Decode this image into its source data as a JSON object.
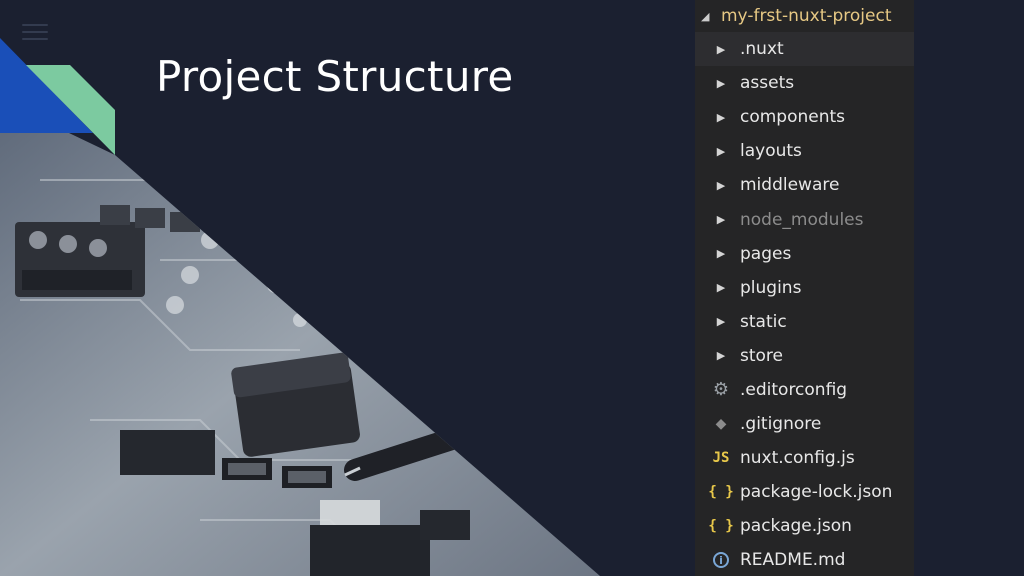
{
  "slide": {
    "title": "Project Structure"
  },
  "explorer": {
    "root_label": "my-frst-nuxt-project",
    "items": [
      {
        "label": ".nuxt",
        "icon": "chevron-right-icon",
        "kind": "folder"
      },
      {
        "label": "assets",
        "icon": "chevron-right-icon",
        "kind": "folder"
      },
      {
        "label": "components",
        "icon": "chevron-right-icon",
        "kind": "folder"
      },
      {
        "label": "layouts",
        "icon": "chevron-right-icon",
        "kind": "folder"
      },
      {
        "label": "middleware",
        "icon": "chevron-right-icon",
        "kind": "folder"
      },
      {
        "label": "node_modules",
        "icon": "chevron-right-icon",
        "kind": "folder"
      },
      {
        "label": "pages",
        "icon": "chevron-right-icon",
        "kind": "folder"
      },
      {
        "label": "plugins",
        "icon": "chevron-right-icon",
        "kind": "folder"
      },
      {
        "label": "static",
        "icon": "chevron-right-icon",
        "kind": "folder"
      },
      {
        "label": "store",
        "icon": "chevron-right-icon",
        "kind": "folder"
      },
      {
        "label": ".editorconfig",
        "icon": "gear-icon",
        "kind": "file"
      },
      {
        "label": ".gitignore",
        "icon": "git-icon",
        "kind": "file"
      },
      {
        "label": "nuxt.config.js",
        "icon": "js-icon",
        "kind": "file",
        "icon_text": "JS"
      },
      {
        "label": "package-lock.json",
        "icon": "json-icon",
        "kind": "file",
        "icon_text": "{ }"
      },
      {
        "label": "package.json",
        "icon": "json-icon",
        "kind": "file",
        "icon_text": "{ }"
      },
      {
        "label": "README.md",
        "icon": "info-icon",
        "kind": "file",
        "icon_text": "i"
      }
    ]
  },
  "colors": {
    "background": "#1b2030",
    "explorer_background": "#252526",
    "root_label": "#e6c884",
    "accent_blue": "#1a4fb8",
    "accent_green": "#7ccaa0"
  }
}
